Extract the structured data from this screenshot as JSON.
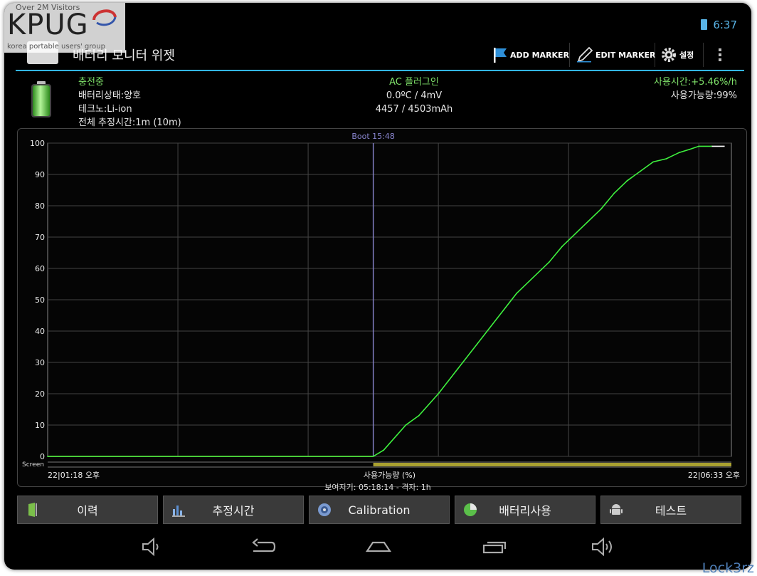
{
  "watermark": {
    "visitors": "Over 2M Visitors",
    "logo": "KPUG",
    "subtitle": "korea portable users' group"
  },
  "corner_watermark": "Lock3rz",
  "status": {
    "time": "6:37"
  },
  "actionbar": {
    "title": "배터리 모니터 위젯",
    "add_marker": "ADD MARKER",
    "edit_marker": "EDIT MARKER",
    "settings": "설정",
    "icons": [
      "flag-icon",
      "pencil-icon",
      "gear-icon",
      "overflow-menu-icon"
    ]
  },
  "info": {
    "charging": "충전중",
    "health": "배터리상태:양호",
    "tech": "테크노:Li-ion",
    "estimate": "전체 추정시간:1m (10m)",
    "plug": "AC 플러그인",
    "temp_volt": "0.0ºC / 4mV",
    "capacity": "4457 / 4503mAh",
    "usage_rate": "사용시간:+5.46%/h",
    "available": "사용가능량:99%"
  },
  "chart_data": {
    "type": "line",
    "title": "",
    "xlabel": "사용가능량 (%)",
    "ylabel": "",
    "ylim": [
      0,
      100
    ],
    "yticks": [
      "0",
      "10",
      "20",
      "30",
      "40",
      "50",
      "60",
      "70",
      "80",
      "90",
      "100"
    ],
    "x_start_label": "22|01:18 오후",
    "x_end_label": "22|06:33 오후",
    "marker_label": "Boot 15:48",
    "screen_label": "Screen",
    "grid": true,
    "x_range_hours": [
      0,
      5.25
    ],
    "marker_x": 2.5,
    "series": [
      {
        "color": "#3ef03e",
        "x": [
          0,
          2.5,
          2.58,
          2.75,
          2.85,
          3.0,
          3.15,
          3.3,
          3.45,
          3.6,
          3.7,
          3.85,
          3.95,
          4.05,
          4.15,
          4.25,
          4.35,
          4.45,
          4.55,
          4.65,
          4.75,
          4.85,
          4.93,
          5.0,
          5.1
        ],
        "y": [
          0,
          0,
          2,
          10,
          13,
          20,
          28,
          36,
          44,
          52,
          56,
          62,
          67,
          71,
          75,
          79,
          84,
          88,
          91,
          94,
          95,
          97,
          98,
          99,
          99
        ]
      }
    ],
    "flat_series_color": "#c8c040",
    "screen_bar_color": "#a8a030"
  },
  "footer": {
    "info": "보여지기: 05:18:14 - 격자: 1h",
    "buttons": [
      "이력",
      "추정시간",
      "Calibration",
      "배터리사용",
      "테스트"
    ]
  },
  "navbar": {
    "icons": [
      "volume-down-icon",
      "back-icon",
      "home-icon",
      "recent-apps-icon",
      "volume-up-icon"
    ]
  }
}
